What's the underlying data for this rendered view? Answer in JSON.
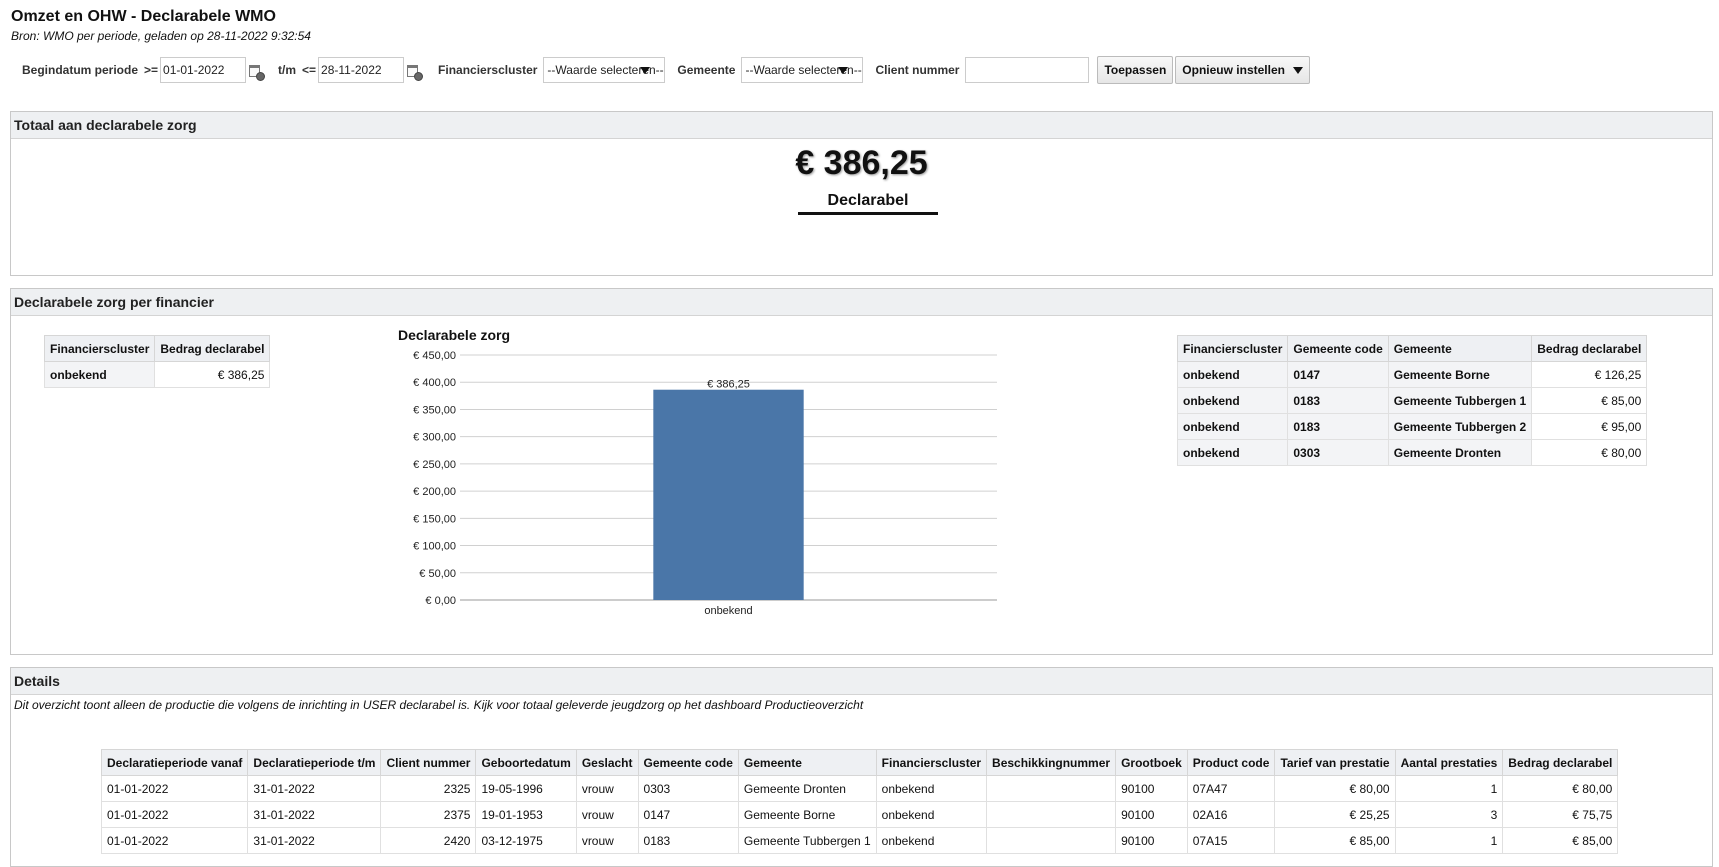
{
  "header": {
    "title": "Omzet en OHW - Declarabele WMO",
    "subtitle": "Bron: WMO per periode, geladen op 28-11-2022 9:32:54"
  },
  "filters": {
    "begin_label": "Begindatum periode",
    "begin_op": ">=",
    "begin_value": "01-01-2022",
    "end_label": "t/m",
    "end_op": "<=",
    "end_value": "28-11-2022",
    "financiers_label": "Financierscluster",
    "financiers_value": "--Waarde selecteren--",
    "gemeente_label": "Gemeente",
    "gemeente_value": "--Waarde selecteren--",
    "client_label": "Client nummer",
    "client_value": "",
    "apply_label": "Toepassen",
    "reset_label": "Opnieuw instellen"
  },
  "totaal": {
    "title": "Totaal aan declarabele zorg",
    "value": "€ 386,25",
    "label": "Declarabel"
  },
  "financier": {
    "title": "Declarabele zorg per financier",
    "left_table": {
      "headers": [
        "Financierscluster",
        "Bedrag declarabel"
      ],
      "rows": [
        [
          "onbekend",
          "€ 386,25"
        ]
      ]
    },
    "right_table": {
      "headers": [
        "Financierscluster",
        "Gemeente code",
        "Gemeente",
        "Bedrag declarabel"
      ],
      "rows": [
        [
          "onbekend",
          "0147",
          "Gemeente Borne",
          "€ 126,25"
        ],
        [
          "onbekend",
          "0183",
          "Gemeente Tubbergen 1",
          "€ 85,00"
        ],
        [
          "onbekend",
          "0183",
          "Gemeente Tubbergen 2",
          "€ 95,00"
        ],
        [
          "onbekend",
          "0303",
          "Gemeente Dronten",
          "€ 80,00"
        ]
      ]
    }
  },
  "chart_data": {
    "type": "bar",
    "title": "Declarabele zorg",
    "categories": [
      "onbekend"
    ],
    "values": [
      386.25
    ],
    "data_labels": [
      "€ 386,25"
    ],
    "ylim": [
      0,
      450
    ],
    "yticks": [
      0,
      50,
      100,
      150,
      200,
      250,
      300,
      350,
      400,
      450
    ],
    "ytick_labels": [
      "€ 0,00",
      "€ 50,00",
      "€ 100,00",
      "€ 150,00",
      "€ 200,00",
      "€ 250,00",
      "€ 300,00",
      "€ 350,00",
      "€ 400,00",
      "€ 450,00"
    ],
    "bar_color": "#4a76a8",
    "grid": true,
    "xlabel": "",
    "ylabel": ""
  },
  "details": {
    "title": "Details",
    "note": "Dit overzicht toont alleen de productie die volgens de inrichting in USER declarabel is. Kijk voor totaal geleverde jeugdzorg op het dashboard Productieoverzicht",
    "headers": [
      "Declaratieperiode vanaf",
      "Declaratieperiode t/m",
      "Client nummer",
      "Geboortedatum",
      "Geslacht",
      "Gemeente code",
      "Gemeente",
      "Financierscluster",
      "Beschikkingnummer",
      "Grootboek",
      "Product code",
      "Tarief van prestatie",
      "Aantal prestaties",
      "Bedrag declarabel"
    ],
    "rows": [
      [
        "01-01-2022",
        "31-01-2022",
        "2325",
        "19-05-1996",
        "vrouw",
        "0303",
        "Gemeente Dronten",
        "onbekend",
        "",
        "90100",
        "07A47",
        "€ 80,00",
        "1",
        "€ 80,00"
      ],
      [
        "01-01-2022",
        "31-01-2022",
        "2375",
        "19-01-1953",
        "vrouw",
        "0147",
        "Gemeente Borne",
        "onbekend",
        "",
        "90100",
        "02A16",
        "€ 25,25",
        "3",
        "€ 75,75"
      ],
      [
        "01-01-2022",
        "31-01-2022",
        "2420",
        "03-12-1975",
        "vrouw",
        "0183",
        "Gemeente Tubbergen 1",
        "onbekend",
        "",
        "90100",
        "07A15",
        "€ 85,00",
        "1",
        "€ 85,00"
      ]
    ]
  }
}
